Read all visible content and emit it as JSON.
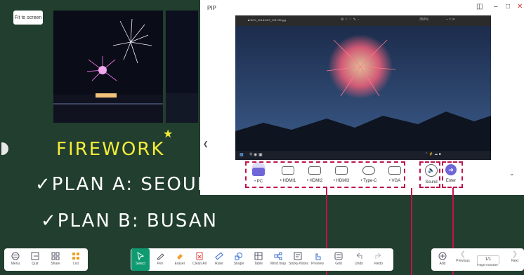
{
  "board": {
    "fit_button": "Fit to screen",
    "handwriting": {
      "line1": "FIREWORK",
      "line2": "✓PLAN A: SEOUL",
      "line3": "✓PLAN B: BUSAN"
    }
  },
  "pip": {
    "title": "PIP",
    "viewer_file": "■ BOX_20181007_201735.jpg",
    "viewer_zoom": "350%",
    "sources": [
      {
        "label": "PC",
        "icon": "monitor-icon",
        "active": true
      },
      {
        "label": "HDMI1",
        "icon": "hdmi-icon",
        "active": false
      },
      {
        "label": "HDMI2",
        "icon": "hdmi-icon",
        "active": false
      },
      {
        "label": "HDMI3",
        "icon": "hdmi-icon",
        "active": false
      },
      {
        "label": "Type-C",
        "icon": "usb-c-icon",
        "active": false
      },
      {
        "label": "VGA",
        "icon": "vga-icon",
        "active": false
      }
    ],
    "sound_label": "Sound",
    "enter_label": "Enter",
    "accent": "#6f65d8",
    "highlight": "#c0144b"
  },
  "toolbar_left": [
    {
      "label": "Menu",
      "icon": "menu-icon"
    },
    {
      "label": "Quit",
      "icon": "quit-icon"
    },
    {
      "label": "Share",
      "icon": "share-icon"
    },
    {
      "label": "List",
      "icon": "list-icon"
    }
  ],
  "toolbar_center": [
    {
      "label": "Select",
      "icon": "select-icon"
    },
    {
      "label": "Pen",
      "icon": "pen-icon"
    },
    {
      "label": "Eraser",
      "icon": "eraser-icon"
    },
    {
      "label": "Clean All",
      "icon": "clean-all-icon"
    },
    {
      "label": "Ruler",
      "icon": "ruler-icon"
    },
    {
      "label": "Shape",
      "icon": "shape-icon"
    },
    {
      "label": "Table",
      "icon": "table-icon"
    },
    {
      "label": "Mind map",
      "icon": "mind-map-icon"
    },
    {
      "label": "Sticky-Notes",
      "icon": "sticky-notes-icon"
    },
    {
      "label": "Preview",
      "icon": "preview-icon"
    },
    {
      "label": "Grid",
      "icon": "grid-icon"
    },
    {
      "label": "Undo",
      "icon": "undo-icon"
    },
    {
      "label": "Redo",
      "icon": "redo-icon"
    }
  ],
  "toolbar_right": {
    "add": "Add",
    "previous": "Previous",
    "page_value": "1/1",
    "page_number": "Page number",
    "next": "Next"
  },
  "colors": {
    "board": "#213e2e",
    "select_active": "#0f9a72",
    "handwriting_yellow": "#f4ec3a"
  }
}
